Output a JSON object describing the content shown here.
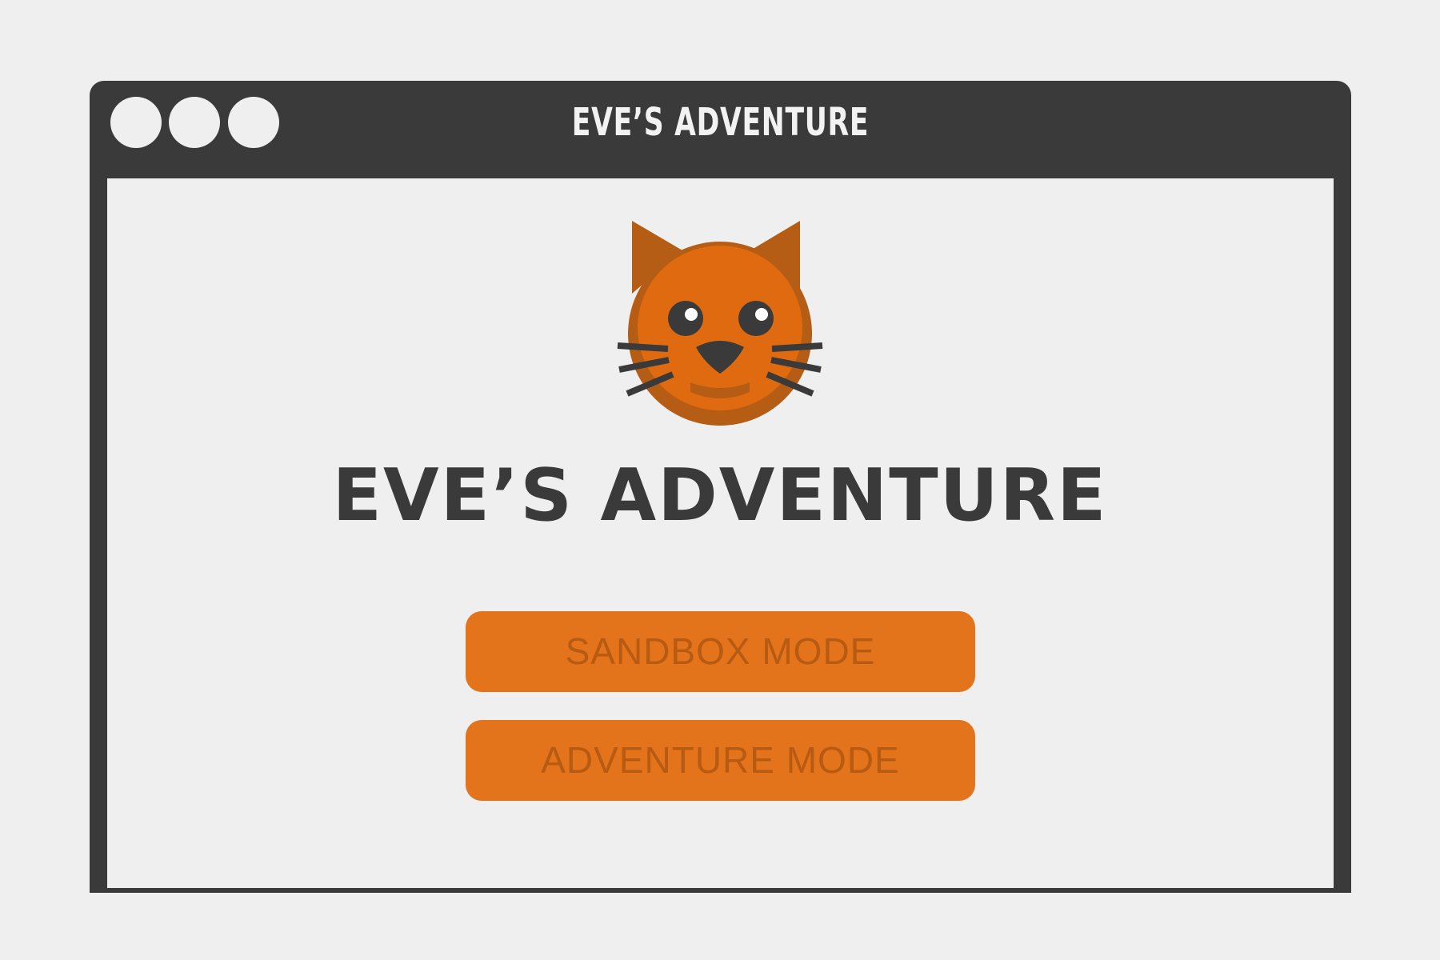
{
  "window": {
    "title": "EVE’S ADVENTURE",
    "controls": [
      "close",
      "minimize",
      "maximize"
    ]
  },
  "main": {
    "title": "EVE’S ADVENTURE",
    "mascot_icon": "cat-face-icon"
  },
  "buttons": {
    "sandbox": "SANDBOX MODE",
    "adventure": "ADVENTURE MODE"
  },
  "colors": {
    "frame": "#3a3a3a",
    "background": "#efefef",
    "button": "#e4741c",
    "button_text": "#b75a12",
    "cat_orange": "#e06a10",
    "cat_dark_orange": "#b55d14"
  }
}
